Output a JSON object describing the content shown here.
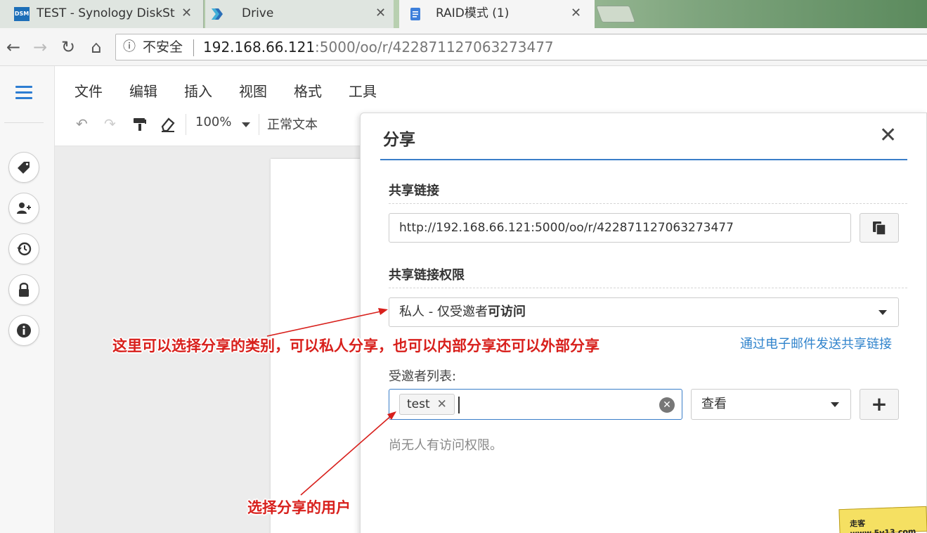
{
  "browser": {
    "tabs": [
      {
        "title": "TEST - Synology DiskSt",
        "favicon": "DSM"
      },
      {
        "title": "Drive"
      },
      {
        "title": "RAID模式 (1)"
      }
    ],
    "tab_close": "✕",
    "address": {
      "insecure_label": "不安全",
      "host": "192.168.66.121",
      "path": ":5000/oo/r/422871127063273477"
    }
  },
  "editor": {
    "menu": [
      "文件",
      "编辑",
      "插入",
      "视图",
      "格式",
      "工具"
    ],
    "toolbar": {
      "zoom": "100%",
      "style": "正常文本"
    }
  },
  "share": {
    "title": "分享",
    "link_section": "共享链接",
    "link_url": "http://192.168.66.121:5000/oo/r/422871127063273477",
    "permission_section": "共享链接权限",
    "permission_prefix": "私人 - 仅受邀者",
    "permission_strong": "可访问",
    "email_link": "通过电子邮件发送共享链接",
    "invitee_label": "受邀者列表:",
    "invitee_chip": "test",
    "role": "查看",
    "no_access": "尚无人有访问权限。"
  },
  "annotations": {
    "type_note": "这里可以选择分享的类别，可以私人分享，也可以内部分享还可以外部分享",
    "user_note": "选择分享的用户"
  },
  "colors": {
    "accent": "#3a7ec9",
    "link": "#2f83cc",
    "annotation": "#d8201c"
  }
}
